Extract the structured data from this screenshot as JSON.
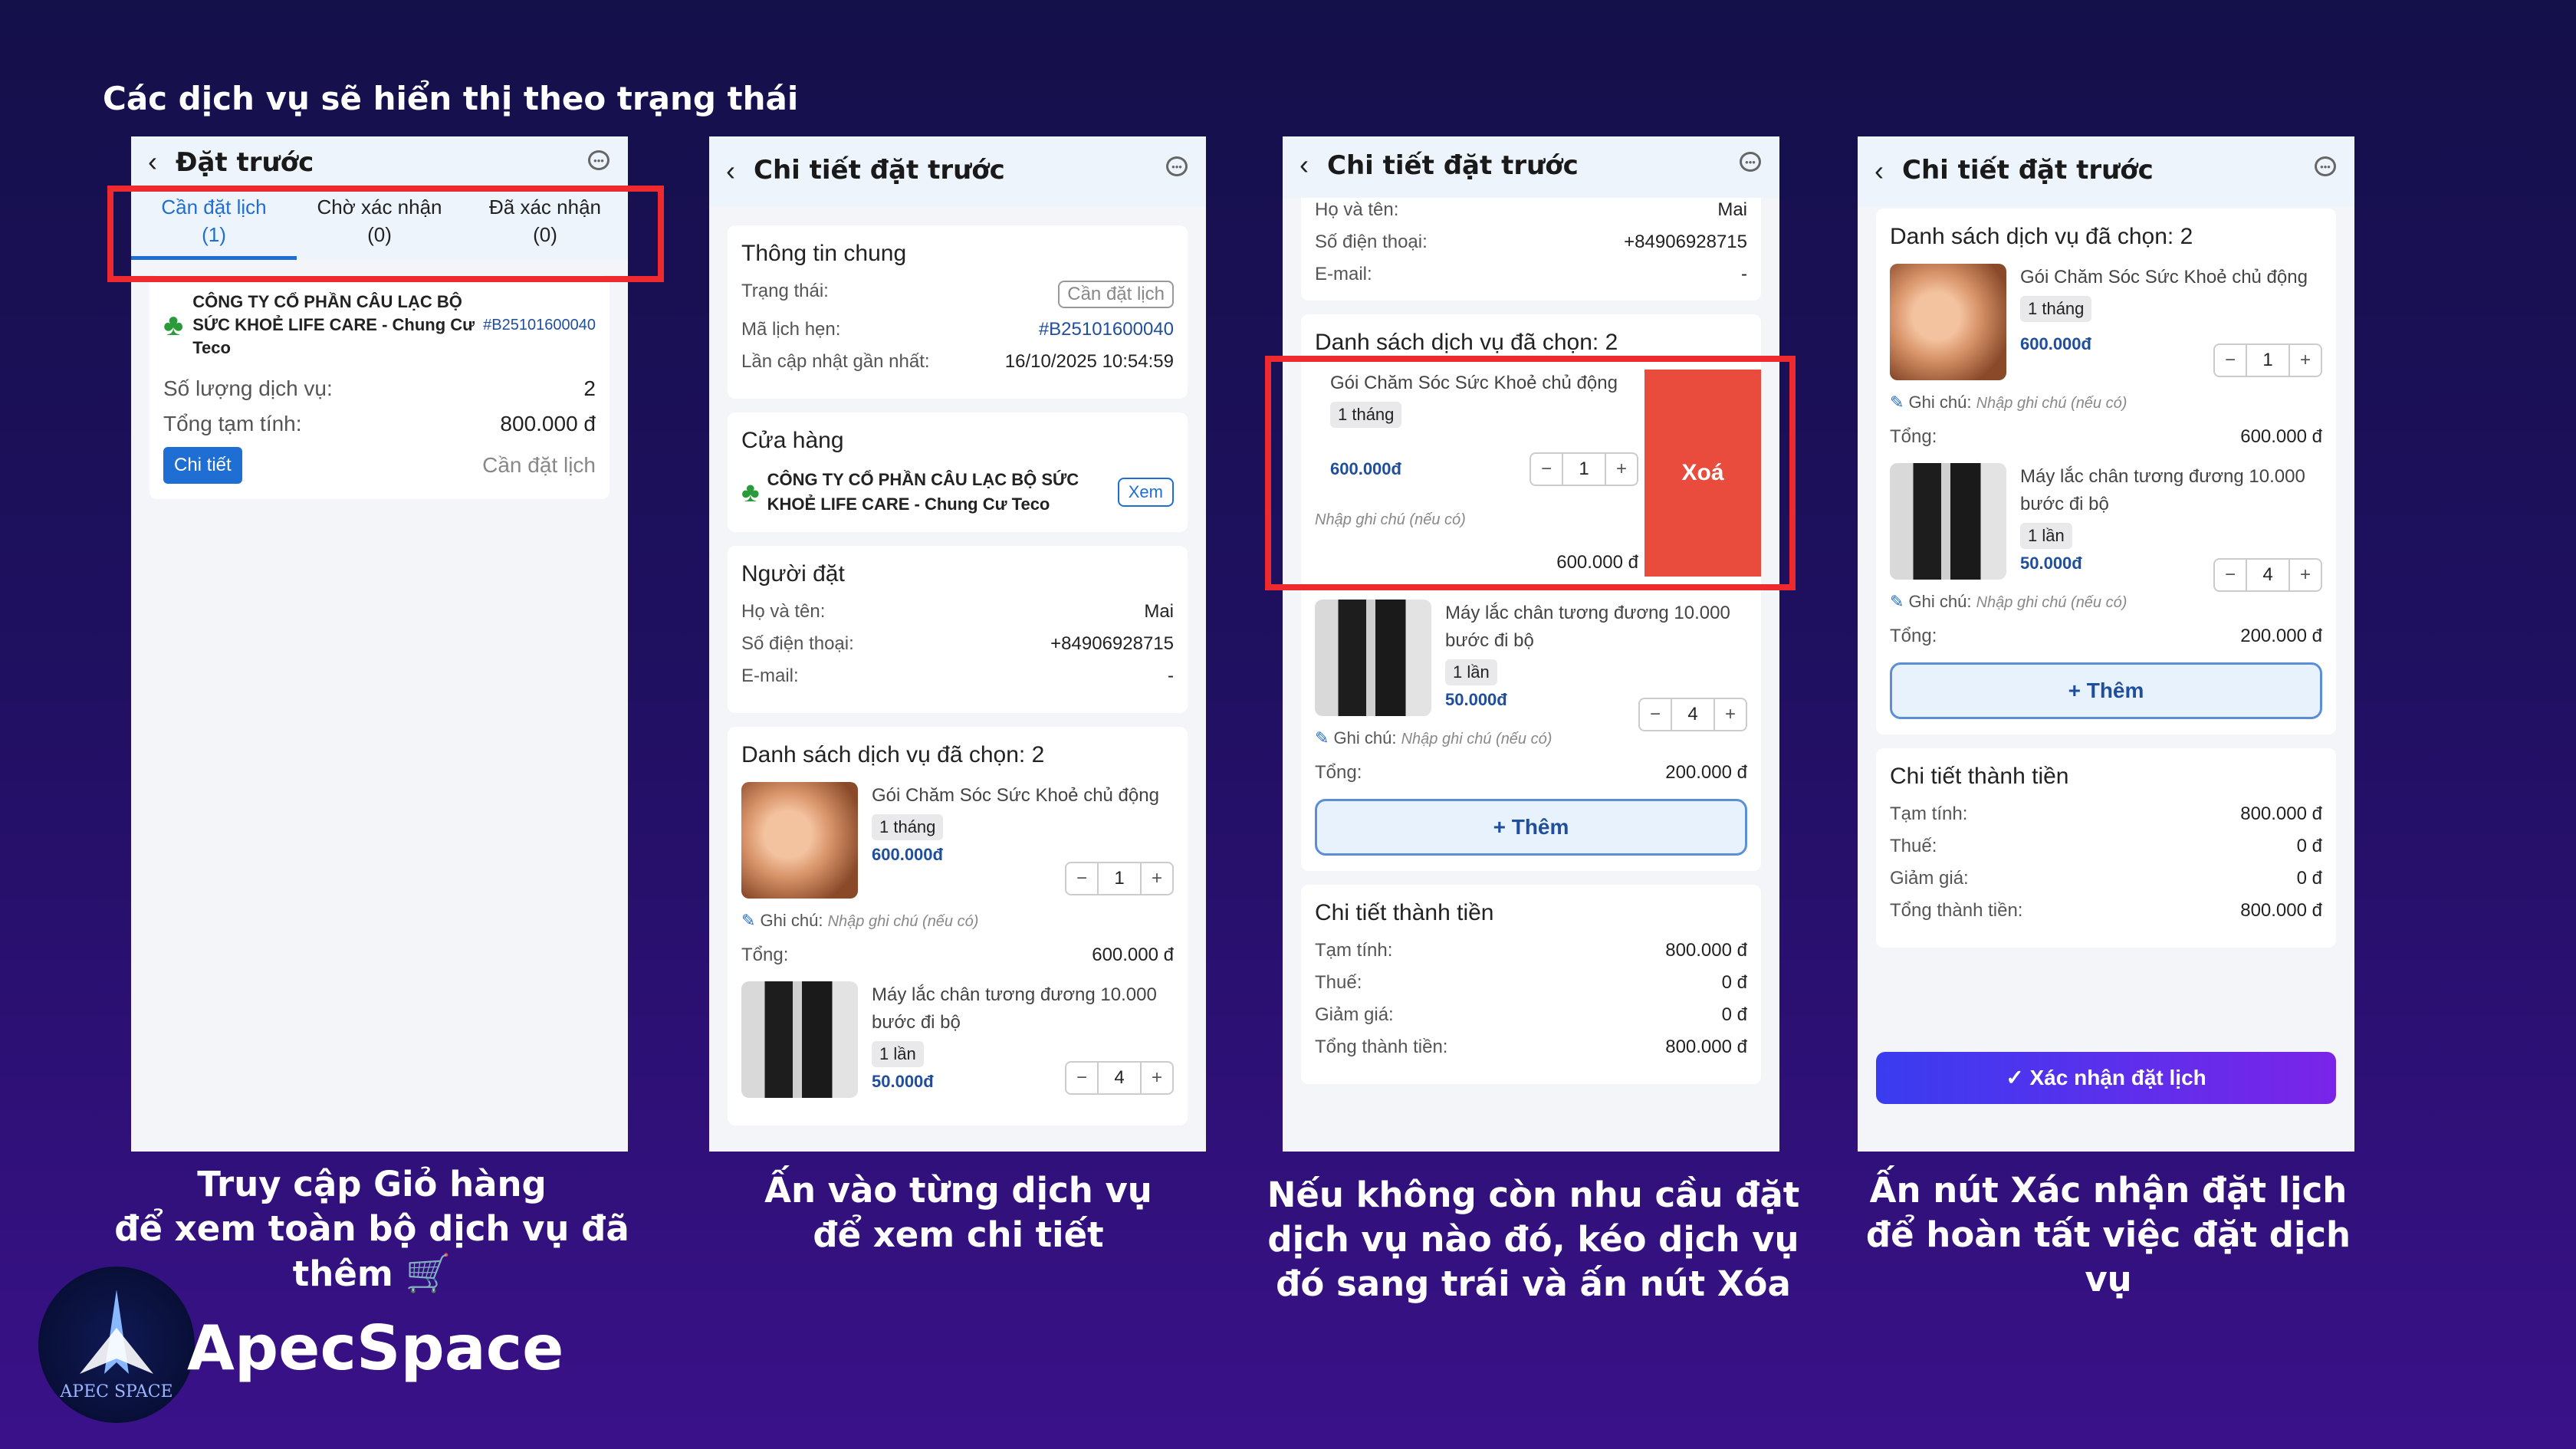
{
  "heading": "Các dịch vụ sẽ hiển thị theo trạng thái",
  "brand": "ApecSpace",
  "logo_text": "APEC SPACE",
  "captions": [
    "Truy cập Giỏ hàng\nđể xem toàn bộ dịch vụ đã thêm",
    "Ấn vào từng dịch vụ\nđể xem chi tiết",
    "Nếu không còn nhu cầu đặt\ndịch vụ nào đó, kéo dịch vụ\nđó sang trái và ấn nút Xóa",
    "Ấn nút Xác nhận đặt lịch\nđể hoàn tất việc đặt dịch vụ"
  ],
  "screen1": {
    "title": "Đặt trước",
    "tabs": [
      {
        "label": "Cần đặt lịch",
        "count": "(1)"
      },
      {
        "label": "Chờ xác nhận",
        "count": "(0)"
      },
      {
        "label": "Đã xác nhận",
        "count": "(0)"
      }
    ],
    "company": "CÔNG TY CỔ PHẦN CÂU LẠC BỘ SỨC KHOẺ LIFE CARE - Chung Cư Teco",
    "code": "#B25101600040",
    "qty_label": "Số lượng dịch vụ:",
    "qty_value": "2",
    "total_label": "Tổng tạm tính:",
    "total_value": "800.000 đ",
    "detail_button": "Chi tiết",
    "status": "Cần đặt lịch"
  },
  "detail_title": "Chi tiết đặt trước",
  "general": {
    "title": "Thông tin chung",
    "status_label": "Trạng thái:",
    "status_value": "Cần đặt lịch",
    "code_label": "Mã lịch hẹn:",
    "code_value": "#B25101600040",
    "update_label": "Lần cập nhật gần nhất:",
    "update_value": "16/10/2025 10:54:59"
  },
  "store": {
    "title": "Cửa hàng",
    "name": "CÔNG TY CỔ PHẦN CÂU LẠC BỘ SỨC KHOẺ LIFE CARE - Chung Cư Teco",
    "view_button": "Xem"
  },
  "booker": {
    "title": "Người đặt",
    "name_label": "Họ và tên:",
    "name_value": "Mai",
    "phone_label": "Số điện thoại:",
    "phone_value": "+84906928715",
    "email_label": "E-mail:",
    "email_value": "-"
  },
  "services": {
    "title": "Danh sách dịch vụ đã chọn: 2",
    "note_label": "Ghi chú:",
    "note_placeholder": "Nhập ghi chú (nếu có)",
    "total_label": "Tổng:",
    "items": [
      {
        "name": "Gói Chăm Sóc Sức Khoẻ chủ động",
        "duration": "1 tháng",
        "price": "600.000đ",
        "qty": "1",
        "total": "600.000 đ"
      },
      {
        "name": "Máy lắc chân tương đương 10.000 bước đi bộ",
        "duration": "1 lần",
        "price": "50.000đ",
        "qty": "4",
        "total": "200.000 đ"
      }
    ],
    "add_button": "Thêm",
    "delete_button": "Xoá"
  },
  "summary": {
    "title": "Chi tiết thành tiền",
    "subtotal_label": "Tạm tính:",
    "subtotal_value": "800.000 đ",
    "tax_label": "Thuế:",
    "tax_value": "0 đ",
    "discount_label": "Giảm giá:",
    "discount_value": "0 đ",
    "total_label": "Tổng thành tiền:",
    "total_value": "800.000 đ"
  },
  "confirm_button": "Xác nhận đặt lịch",
  "colors": {
    "accent": "#1f6ed4",
    "highlight": "#ee2a2e",
    "delete": "#e94b3c"
  }
}
